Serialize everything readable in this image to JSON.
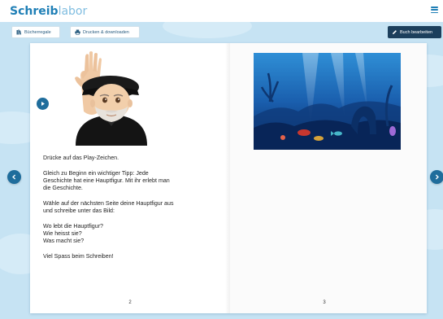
{
  "brand": {
    "strong": "Schreib",
    "light": "labor"
  },
  "toolbar": {
    "shelf_label": "Bücherregale",
    "print_label": "Drucken & downloaden",
    "edit_label": "Buch bearbeiten"
  },
  "left_page": {
    "paragraphs": [
      "Drücke auf das Play-Zeichen.",
      "Gleich zu Beginn ein wichtiger Tipp: Jede\nGeschichte hat eine Hauptfigur. Mit ihr erlebt man\ndie Geschichte.",
      "Wähle auf der nächsten Seite deine Hauptfigur aus\nund schreibe unter das Bild:",
      "Wo lebt die Hauptfigur?\nWie heisst sie?\nWas macht sie?",
      "Viel Spass beim Schreiben!"
    ],
    "page_number": "2"
  },
  "right_page": {
    "page_number": "3"
  },
  "icons": {
    "menu": "hamburger-menu-icon",
    "shelf": "bookshelf-icon",
    "print": "printer-icon",
    "edit": "pencil-icon",
    "play": "play-icon",
    "prev": "chevron-left-icon",
    "next": "chevron-right-icon"
  },
  "colors": {
    "brand_blue": "#1f7fb6",
    "stage_bg": "#c6e3f3",
    "nav_blue": "#1f6d9c",
    "edit_button": "#1c3f5c"
  }
}
